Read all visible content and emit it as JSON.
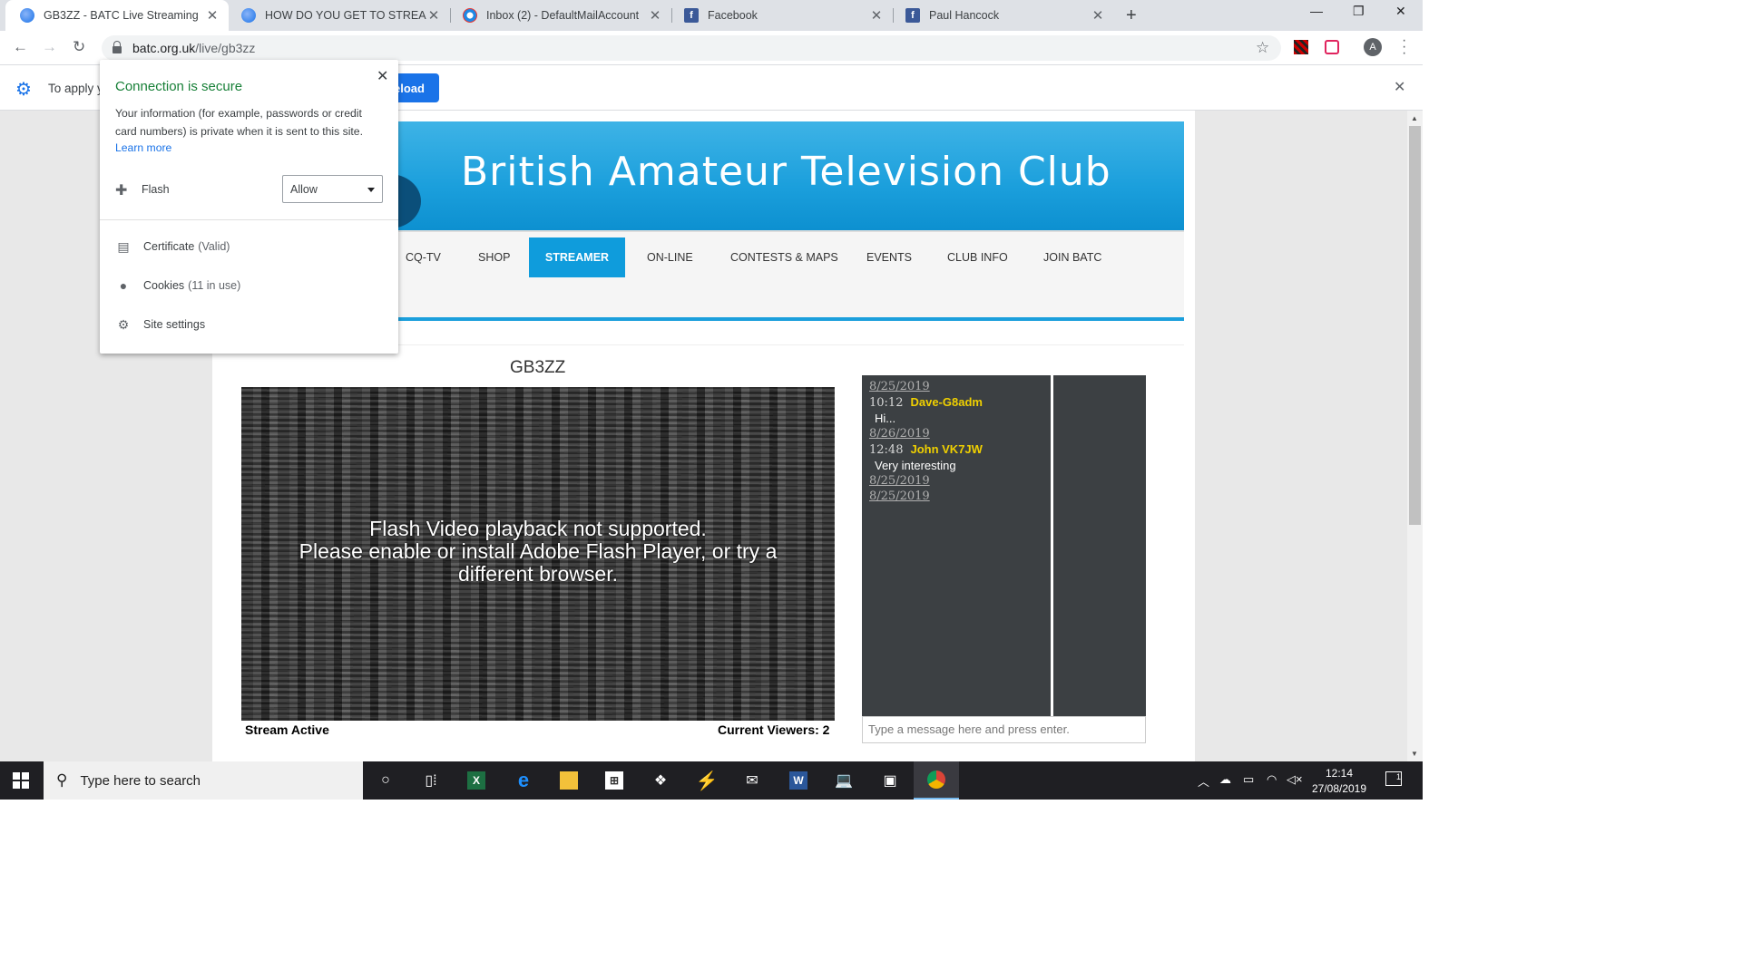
{
  "browser": {
    "tabs": [
      {
        "title": "GB3ZZ - BATC Live Streaming",
        "favicon": "batc-globe-icon",
        "active": true
      },
      {
        "title": "HOW DO YOU GET TO STREAM/",
        "favicon": "batc-globe-icon",
        "active": false
      },
      {
        "title": "Inbox (2) - DefaultMailAccount",
        "favicon": "mail-icon",
        "active": false
      },
      {
        "title": "Facebook",
        "favicon": "facebook-icon",
        "active": false
      },
      {
        "title": "Paul Hancock",
        "favicon": "facebook-icon",
        "active": false
      }
    ],
    "url_host": "batc.org.uk",
    "url_path": "/live/gb3zz",
    "profile_initial": "A"
  },
  "infobar": {
    "message": "To apply y",
    "button": "eload"
  },
  "popup": {
    "heading": "Connection is secure",
    "description": "Your information (for example, passwords or credit card numbers) is private when it is sent to this site.",
    "learn_more": "Learn more",
    "flash_label": "Flash",
    "flash_value": "Allow",
    "certificate_label": "Certificate",
    "certificate_status": "(Valid)",
    "cookies_label": "Cookies",
    "cookies_status": "(11 in use)",
    "site_settings": "Site settings",
    "heading_color": "#188038"
  },
  "site": {
    "brand": "British Amateur Television Club",
    "nav": [
      "CQ-TV",
      "SHOP",
      "STREAMER",
      "ON-LINE",
      "CONTESTS & MAPS",
      "EVENTS",
      "CLUB INFO",
      "JOIN BATC"
    ],
    "active_nav": "STREAMER",
    "accent_color": "#0f9cdc",
    "stream_title": "GB3ZZ",
    "video_message_1": "Flash Video playback not supported.",
    "video_message_2": "Please enable or install Adobe Flash Player, or try a",
    "video_message_3": "different browser.",
    "stream_status": "Stream Active",
    "viewers": "Current Viewers: 2",
    "chat_placeholder": "Type a message here and press enter.",
    "chat": [
      {
        "date": "8/25/2019",
        "time": "10:12",
        "user": "Dave-G8adm",
        "text": "Hi..."
      },
      {
        "date": "8/26/2019",
        "time": "12:48",
        "user": "John VK7JW",
        "text": "Very interesting"
      },
      {
        "date": "8/25/2019"
      },
      {
        "date": "8/25/2019"
      }
    ]
  },
  "taskbar": {
    "search_placeholder": "Type here to search",
    "time": "12:14",
    "date": "27/08/2019",
    "notifications": "1"
  }
}
